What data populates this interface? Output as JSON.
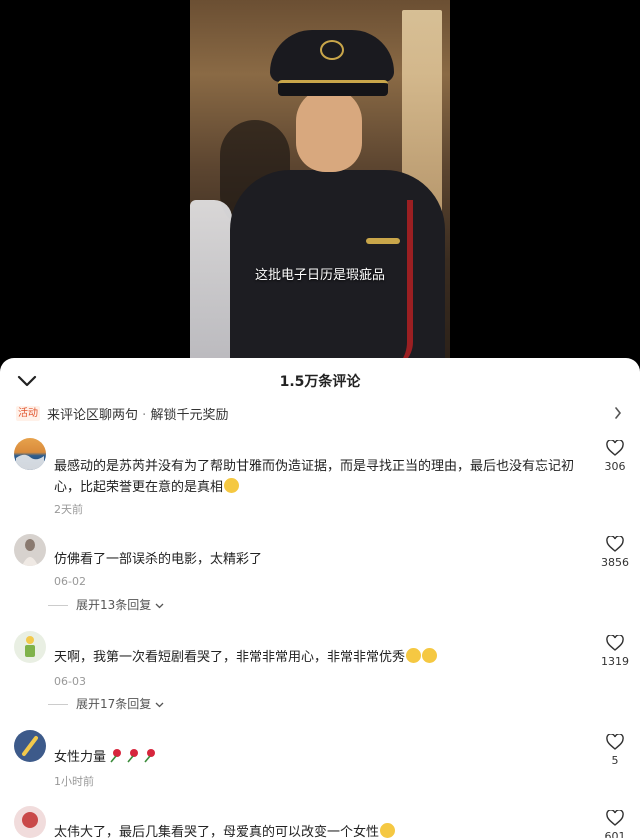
{
  "video": {
    "subtitle": "这批电子日历是瑕疵品"
  },
  "sheet": {
    "title": "1.5万条评论",
    "promo_tag": "活动",
    "promo_text": "来评论区聊两句",
    "promo_separator": "·",
    "promo_text2": "解锁千元奖励"
  },
  "comments": [
    {
      "text": "最感动的是苏芮并没有为了帮助甘雅而伪造证据，而是寻找正当的理由，最后也没有忘记初心，比起荣誉更在意的是真相",
      "time": "2天前",
      "likes": "306"
    },
    {
      "text": "仿佛看了一部误杀的电影，太精彩了",
      "time": "06-02",
      "replies": "展开13条回复",
      "likes": "3856"
    },
    {
      "text": "天啊，我第一次看短剧看哭了，非常非常用心，非常非常优秀",
      "time": "06-03",
      "replies": "展开17条回复",
      "likes": "1319"
    },
    {
      "text": "女性力量",
      "time": "1小时前",
      "likes": "5"
    },
    {
      "text": "太伟大了，最后几集看哭了，母爱真的可以改变一个女性",
      "likes": "601"
    }
  ],
  "colors": {
    "accent": "#e0532c",
    "subtle": "#999999"
  }
}
